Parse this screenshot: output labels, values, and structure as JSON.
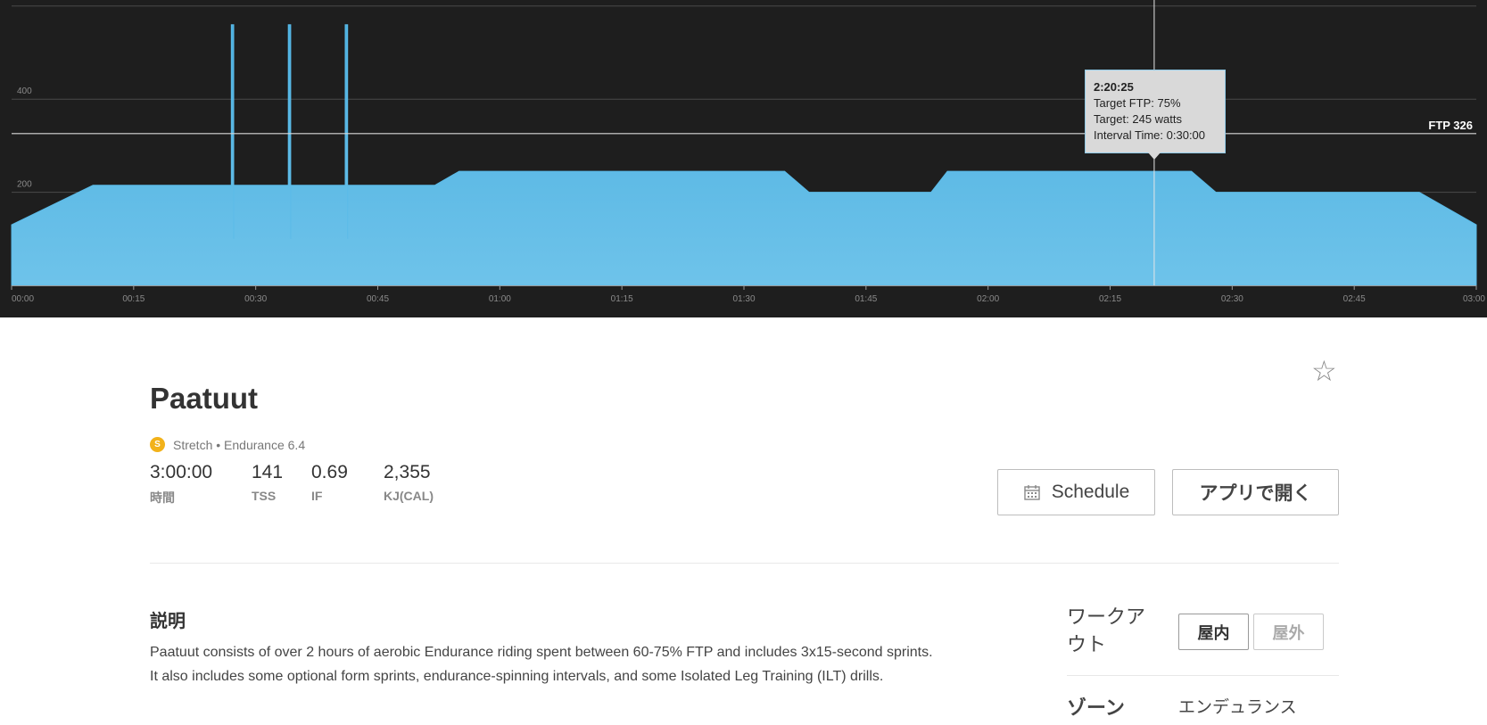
{
  "chart": {
    "ftp_label": "FTP 326",
    "y_tick_labels": [
      "400",
      "200"
    ],
    "x_tick_labels": [
      "00:00",
      "00:15",
      "00:30",
      "00:45",
      "01:00",
      "01:15",
      "01:30",
      "01:45",
      "02:00",
      "02:15",
      "02:30",
      "02:45",
      "03:00"
    ],
    "tooltip": {
      "time": "2:20:25",
      "target_ftp": "Target FTP: 75%",
      "target_watts": "Target: 245 watts",
      "interval_time": "Interval Time: 0:30:00"
    },
    "fill_color": "#4fb3e3",
    "background_color": "#1e1e1e"
  },
  "chart_data": {
    "type": "area",
    "xlabel": "",
    "ylabel": "",
    "x_unit": "minutes",
    "xlim": [
      0,
      180
    ],
    "ylim": [
      0,
      600
    ],
    "ftp": 326,
    "cursor_time": "2:20:25",
    "series": [
      {
        "x": [
          0,
          10,
          27,
          27,
          27.3,
          27.3,
          27.3,
          34,
          34,
          34.3,
          34.3,
          34.3,
          41,
          41,
          41.3,
          41.3,
          41.3,
          52,
          55,
          95,
          98,
          113,
          115,
          145,
          148,
          173,
          180
        ],
        "y": [
          130,
          215,
          215,
          560,
          560,
          100,
          215,
          215,
          560,
          560,
          100,
          215,
          215,
          560,
          560,
          100,
          215,
          215,
          245,
          245,
          200,
          200,
          245,
          245,
          200,
          200,
          130
        ]
      }
    ]
  },
  "workout": {
    "title": "Paatuut",
    "badge_letter": "S",
    "meta_text": "Stretch • Endurance 6.4",
    "stats": [
      {
        "value": "3:00:00",
        "label": "時間"
      },
      {
        "value": "141",
        "label": "TSS"
      },
      {
        "value": "0.69",
        "label": "IF"
      },
      {
        "value": "2,355",
        "label": "KJ(CAL)"
      }
    ],
    "star_icon": "☆"
  },
  "actions": {
    "schedule_label": "Schedule",
    "open_app_label": "アプリで開く"
  },
  "description": {
    "heading": "説明",
    "text": "Paatuut consists of over 2 hours of aerobic Endurance riding spent between 60-75% FTP and includes 3x15-second sprints. It also includes some optional form sprints, endurance-spinning intervals, and some Isolated Leg Training (ILT) drills."
  },
  "sidebar": {
    "workout_label": "ワークアウト",
    "indoor_label": "屋内",
    "outdoor_label": "屋外",
    "zone_label": "ゾーン",
    "zone_value": "エンデュランス"
  }
}
